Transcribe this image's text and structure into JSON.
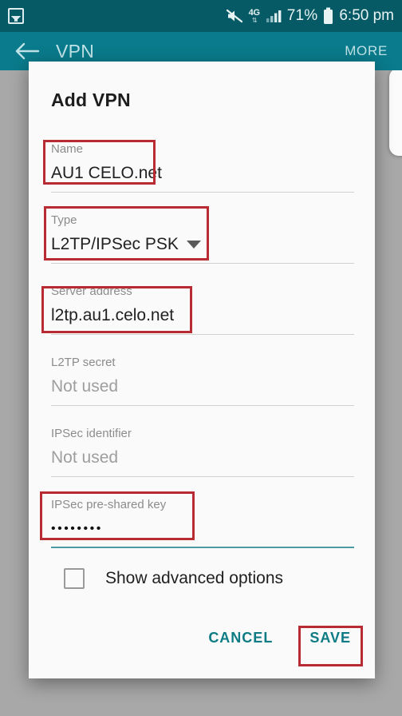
{
  "statusbar": {
    "left_icon": "screenshot-icon",
    "mute_icon": "mute-icon",
    "network_label": "4G",
    "network_arrows": "⇅",
    "signal_icon": "signal-bars-icon",
    "battery_percent": "71%",
    "battery_icon": "battery-icon",
    "time": "6:50 pm"
  },
  "appbar": {
    "back_icon": "back-arrow-icon",
    "title": "VPN",
    "more_label": "MORE"
  },
  "dialog": {
    "title": "Add VPN",
    "fields": [
      {
        "label": "Name",
        "value": "AU1 CELO.net",
        "type": "text",
        "focused": false,
        "annotated": true
      },
      {
        "label": "Type",
        "value": "L2TP/IPSec PSK",
        "type": "dropdown",
        "focused": false,
        "annotated": true
      },
      {
        "label": "Server address",
        "value": "l2tp.au1.celo.net",
        "type": "text",
        "focused": false,
        "annotated": true
      },
      {
        "label": "L2TP secret",
        "value": "Not used",
        "type": "placeholder",
        "focused": false,
        "annotated": false
      },
      {
        "label": "IPSec identifier",
        "value": "Not used",
        "type": "placeholder",
        "focused": false,
        "annotated": false
      },
      {
        "label": "IPSec pre-shared key",
        "value": "••••••••",
        "type": "password",
        "focused": true,
        "annotated": true
      }
    ],
    "checkbox": {
      "label": "Show advanced options",
      "checked": false
    },
    "cancel_label": "CANCEL",
    "save_label": "SAVE"
  },
  "colors": {
    "statusbar_bg": "#065a65",
    "appbar_bg": "#0a7b8c",
    "accent_teal": "#0c7b84",
    "annotation_red": "#b92b32",
    "scrim": "#a8a8a8"
  }
}
